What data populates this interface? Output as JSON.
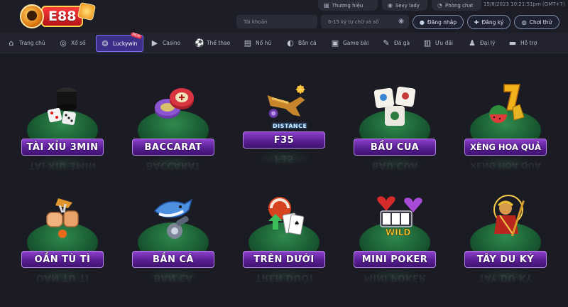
{
  "brand": {
    "logo_text": "E88"
  },
  "top_links": [
    {
      "label": "Thương hiệu",
      "icon": "storefront-icon"
    },
    {
      "label": "Sexy lady",
      "icon": "camera-icon"
    },
    {
      "label": "Phòng chat",
      "icon": "chat-icon"
    }
  ],
  "datetime": "15/8/2023 10:21:51pm (GMT+7)",
  "login": {
    "username_placeholder": "Tài khoản",
    "password_placeholder": "6-15 ký tự chữ và số",
    "login_label": "Đăng nhập",
    "register_label": "Đăng ký",
    "trial_label": "Chơi thử"
  },
  "nav": [
    {
      "label": "Trang chủ",
      "icon": "home-icon"
    },
    {
      "label": "Xổ số",
      "icon": "lottery-icon"
    },
    {
      "label": "Luckywin",
      "icon": "ball-icon",
      "active": true,
      "tag": "NEW"
    },
    {
      "label": "Casino",
      "icon": "play-icon"
    },
    {
      "label": "Thể thao",
      "icon": "soccer-ball-icon"
    },
    {
      "label": "Nổ hũ",
      "icon": "slot-machine-icon"
    },
    {
      "label": "Bắn cá",
      "icon": "fish-icon"
    },
    {
      "label": "Game bài",
      "icon": "cards-icon"
    },
    {
      "label": "Đá gà",
      "icon": "rooster-icon"
    },
    {
      "label": "Ưu đãi",
      "icon": "gift-icon"
    },
    {
      "label": "Đại lý",
      "icon": "agent-icon"
    },
    {
      "label": "Hỗ trợ",
      "icon": "support-icon"
    }
  ],
  "games": [
    {
      "name": "TÀI XỈU 3MIN",
      "icon": "dice-cup-icon"
    },
    {
      "name": "BACCARAT",
      "icon": "poker-chips-icon"
    },
    {
      "name": "F35",
      "icon": "fighter-jet-icon",
      "badge": "DISTANCE"
    },
    {
      "name": "BẦU CUA",
      "icon": "bau-cua-dice-icon"
    },
    {
      "name": "XÈNG HOA QUẢ",
      "icon": "fruit-slot-icon"
    },
    {
      "name": "OẲN TÙ TÌ",
      "icon": "rock-paper-scissors-icon"
    },
    {
      "name": "BẮN CÁ",
      "icon": "shark-cannon-icon"
    },
    {
      "name": "TRÊN DƯỚI",
      "icon": "cards-arrows-icon"
    },
    {
      "name": "MINI POKER",
      "icon": "wild-slot-icon"
    },
    {
      "name": "TÂY DU KÝ",
      "icon": "monkey-king-icon"
    }
  ],
  "colors": {
    "background": "#1a1b23",
    "nav_active": "#3b2f8a",
    "ribbon": "#6a2aa8",
    "platform": "#2f8a4e"
  }
}
